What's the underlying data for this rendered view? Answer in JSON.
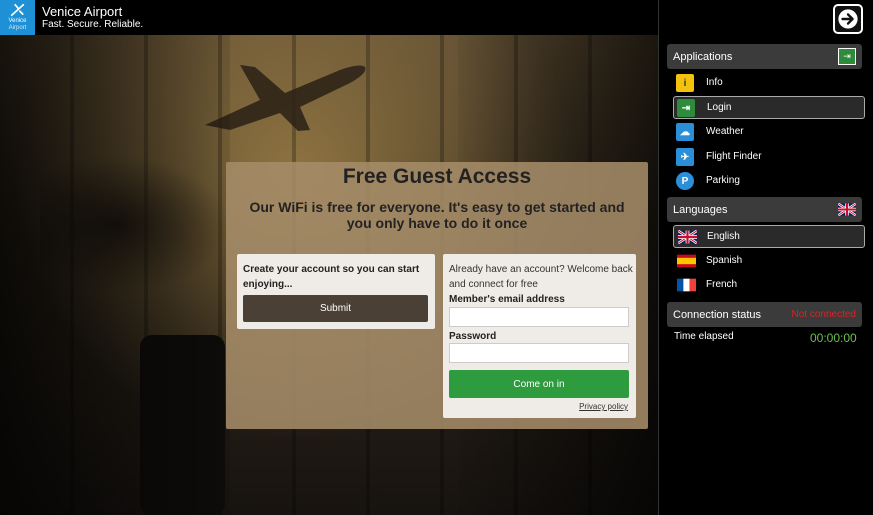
{
  "header": {
    "logo_line1": "Venice",
    "logo_line2": "Airport",
    "title": "Venice Airport",
    "tagline": "Fast. Secure. Reliable."
  },
  "panel": {
    "title": "Free Guest Access",
    "subtitle": "Our WiFi is free for everyone. It's easy to get started and you only have to do it once",
    "create": {
      "text": "Create your account so you can start enjoying...",
      "submit_label": "Submit"
    },
    "login": {
      "already_text": "Already have an account? Welcome back and connect for free",
      "email_label": "Member's email address",
      "email_value": "",
      "password_label": "Password",
      "password_value": "",
      "button_label": "Come on in",
      "privacy_label": "Privacy policy"
    }
  },
  "sidebar": {
    "applications_label": "Applications",
    "apps": [
      {
        "label": "Info",
        "icon": "info-icon",
        "color": "#f2c20e"
      },
      {
        "label": "Login",
        "icon": "login-icon",
        "color": "#2e8b3c",
        "active": true
      },
      {
        "label": "Weather",
        "icon": "cloud-icon",
        "color": "#2a8fd8"
      },
      {
        "label": "Flight Finder",
        "icon": "plane-icon",
        "color": "#2a8fd8"
      },
      {
        "label": "Parking",
        "icon": "parking-icon",
        "color": "#2a8fd8"
      }
    ],
    "languages_label": "Languages",
    "languages": [
      {
        "label": "English",
        "icon": "uk-flag-icon",
        "active": true
      },
      {
        "label": "Spanish",
        "icon": "spain-flag-icon"
      },
      {
        "label": "French",
        "icon": "france-flag-icon"
      }
    ],
    "connection_label": "Connection status",
    "connection_status": "Not connected",
    "elapsed_label": "Time elapsed",
    "elapsed_value": "00:00:00"
  }
}
